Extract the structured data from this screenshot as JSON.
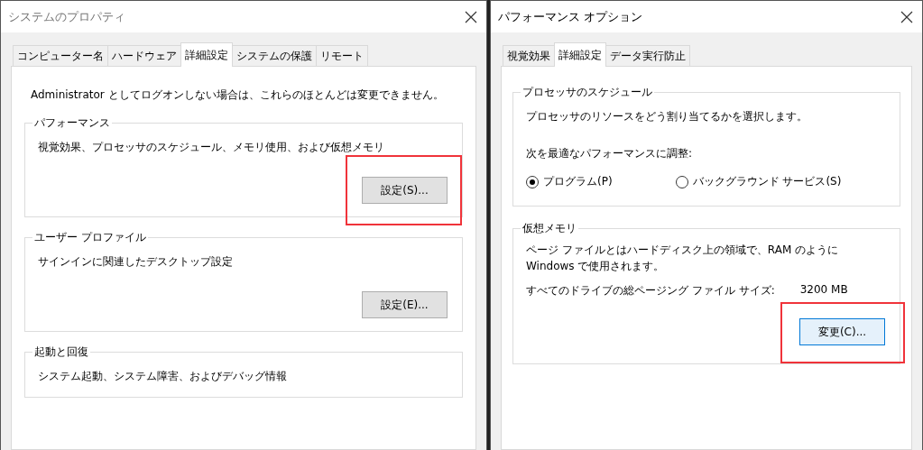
{
  "system_properties": {
    "title": "システムのプロパティ",
    "tabs": [
      {
        "label": "コンピューター名",
        "selected": false
      },
      {
        "label": "ハードウェア",
        "selected": false
      },
      {
        "label": "詳細設定",
        "selected": true
      },
      {
        "label": "システムの保護",
        "selected": false
      },
      {
        "label": "リモート",
        "selected": false
      }
    ],
    "note": "Administrator としてログオンしない場合は、これらのほとんどは変更できません。",
    "groups": [
      {
        "title": "パフォーマンス",
        "description": "視覚効果、プロセッサのスケジュール、メモリ使用、および仮想メモリ",
        "button": {
          "label": "設定(S)...",
          "focused": false,
          "highlighted": true
        }
      },
      {
        "title": "ユーザー プロファイル",
        "description": "サインインに関連したデスクトップ設定",
        "button": {
          "label": "設定(E)...",
          "focused": false,
          "highlighted": false
        }
      },
      {
        "title": "起動と回復",
        "description": "システム起動、システム障害、およびデバッグ情報"
      }
    ]
  },
  "performance_options": {
    "title": "パフォーマンス オプション",
    "tabs": [
      {
        "label": "視覚効果",
        "selected": false
      },
      {
        "label": "詳細設定",
        "selected": true
      },
      {
        "label": "データ実行防止",
        "selected": false
      }
    ],
    "processor_group": {
      "title": "プロセッサのスケジュール",
      "description": "プロセッサのリソースをどう割り当てるかを選択します。",
      "adjust_label": "次を最適なパフォーマンスに調整:",
      "radios": [
        {
          "label": "プログラム(P)",
          "selected": true
        },
        {
          "label": "バックグラウンド サービス(S)",
          "selected": false
        }
      ]
    },
    "memory_group": {
      "title": "仮想メモリ",
      "description": "ページ ファイルとはハードディスク上の領域で、RAM のように\nWindows で使用されます。",
      "size_label": "すべてのドライブの総ページング ファイル サイズ:",
      "size_value": "3200 MB",
      "button": {
        "label": "変更(C)...",
        "focused": true,
        "highlighted": true
      }
    }
  }
}
